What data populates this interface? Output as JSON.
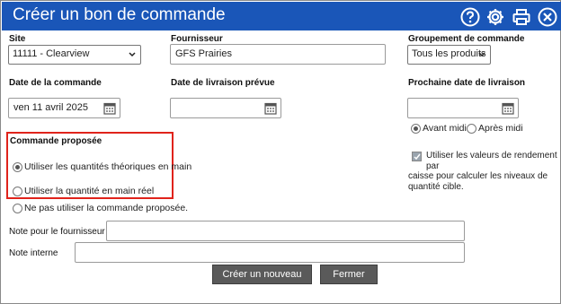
{
  "window": {
    "title": "Créer un bon de commande",
    "icons": [
      "help-icon",
      "gear-icon",
      "print-icon",
      "close-icon"
    ],
    "accent": "#1a56b8"
  },
  "fields": {
    "site_label": "Site",
    "site_value": "11111 - Clearview",
    "supplier_label": "Fournisseur",
    "supplier_value": "GFS Prairies",
    "group_label": "Groupement de commande",
    "group_value": "Tous les produits",
    "order_date_label": "Date de la commande",
    "order_date_value": "ven 11 avril 2025",
    "delivery_label": "Date de livraison prévue",
    "delivery_value": "",
    "next_delivery_label": "Prochaine date de livraison",
    "next_delivery_value": ""
  },
  "time_options": {
    "am": "Avant midi",
    "pm": "Après midi",
    "selected": "am"
  },
  "proposed": {
    "heading": "Commande proposée",
    "option1": "Utiliser les quantités théoriques en main",
    "option2": "Utiliser la quantité en main réel",
    "option3": "Ne pas utiliser la commande proposée.",
    "selected": "option1"
  },
  "yield": {
    "checked": true,
    "line1": "Utiliser les valeurs de rendement par",
    "line2": "caisse pour calculer les niveaux de",
    "line3": "quantité cible."
  },
  "notes": {
    "supplier_label": "Note pour le fournisseur",
    "supplier_value": "",
    "internal_label": "Note interne",
    "internal_value": ""
  },
  "buttons": {
    "create": "Créer un nouveau",
    "close": "Fermer"
  },
  "colors": {
    "highlight": "#e0231b",
    "button_bg": "#5a5a5a"
  }
}
